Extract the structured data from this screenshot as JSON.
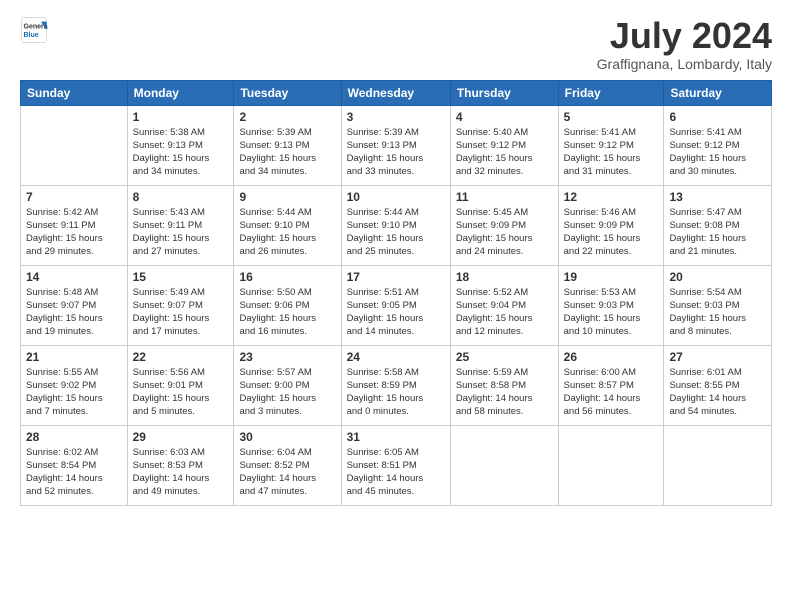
{
  "header": {
    "logo_line1": "General",
    "logo_line2": "Blue",
    "month": "July 2024",
    "location": "Graffignana, Lombardy, Italy"
  },
  "days_of_week": [
    "Sunday",
    "Monday",
    "Tuesday",
    "Wednesday",
    "Thursday",
    "Friday",
    "Saturday"
  ],
  "weeks": [
    [
      {
        "day": "",
        "info": ""
      },
      {
        "day": "1",
        "info": "Sunrise: 5:38 AM\nSunset: 9:13 PM\nDaylight: 15 hours\nand 34 minutes."
      },
      {
        "day": "2",
        "info": "Sunrise: 5:39 AM\nSunset: 9:13 PM\nDaylight: 15 hours\nand 34 minutes."
      },
      {
        "day": "3",
        "info": "Sunrise: 5:39 AM\nSunset: 9:13 PM\nDaylight: 15 hours\nand 33 minutes."
      },
      {
        "day": "4",
        "info": "Sunrise: 5:40 AM\nSunset: 9:12 PM\nDaylight: 15 hours\nand 32 minutes."
      },
      {
        "day": "5",
        "info": "Sunrise: 5:41 AM\nSunset: 9:12 PM\nDaylight: 15 hours\nand 31 minutes."
      },
      {
        "day": "6",
        "info": "Sunrise: 5:41 AM\nSunset: 9:12 PM\nDaylight: 15 hours\nand 30 minutes."
      }
    ],
    [
      {
        "day": "7",
        "info": "Sunrise: 5:42 AM\nSunset: 9:11 PM\nDaylight: 15 hours\nand 29 minutes."
      },
      {
        "day": "8",
        "info": "Sunrise: 5:43 AM\nSunset: 9:11 PM\nDaylight: 15 hours\nand 27 minutes."
      },
      {
        "day": "9",
        "info": "Sunrise: 5:44 AM\nSunset: 9:10 PM\nDaylight: 15 hours\nand 26 minutes."
      },
      {
        "day": "10",
        "info": "Sunrise: 5:44 AM\nSunset: 9:10 PM\nDaylight: 15 hours\nand 25 minutes."
      },
      {
        "day": "11",
        "info": "Sunrise: 5:45 AM\nSunset: 9:09 PM\nDaylight: 15 hours\nand 24 minutes."
      },
      {
        "day": "12",
        "info": "Sunrise: 5:46 AM\nSunset: 9:09 PM\nDaylight: 15 hours\nand 22 minutes."
      },
      {
        "day": "13",
        "info": "Sunrise: 5:47 AM\nSunset: 9:08 PM\nDaylight: 15 hours\nand 21 minutes."
      }
    ],
    [
      {
        "day": "14",
        "info": "Sunrise: 5:48 AM\nSunset: 9:07 PM\nDaylight: 15 hours\nand 19 minutes."
      },
      {
        "day": "15",
        "info": "Sunrise: 5:49 AM\nSunset: 9:07 PM\nDaylight: 15 hours\nand 17 minutes."
      },
      {
        "day": "16",
        "info": "Sunrise: 5:50 AM\nSunset: 9:06 PM\nDaylight: 15 hours\nand 16 minutes."
      },
      {
        "day": "17",
        "info": "Sunrise: 5:51 AM\nSunset: 9:05 PM\nDaylight: 15 hours\nand 14 minutes."
      },
      {
        "day": "18",
        "info": "Sunrise: 5:52 AM\nSunset: 9:04 PM\nDaylight: 15 hours\nand 12 minutes."
      },
      {
        "day": "19",
        "info": "Sunrise: 5:53 AM\nSunset: 9:03 PM\nDaylight: 15 hours\nand 10 minutes."
      },
      {
        "day": "20",
        "info": "Sunrise: 5:54 AM\nSunset: 9:03 PM\nDaylight: 15 hours\nand 8 minutes."
      }
    ],
    [
      {
        "day": "21",
        "info": "Sunrise: 5:55 AM\nSunset: 9:02 PM\nDaylight: 15 hours\nand 7 minutes."
      },
      {
        "day": "22",
        "info": "Sunrise: 5:56 AM\nSunset: 9:01 PM\nDaylight: 15 hours\nand 5 minutes."
      },
      {
        "day": "23",
        "info": "Sunrise: 5:57 AM\nSunset: 9:00 PM\nDaylight: 15 hours\nand 3 minutes."
      },
      {
        "day": "24",
        "info": "Sunrise: 5:58 AM\nSunset: 8:59 PM\nDaylight: 15 hours\nand 0 minutes."
      },
      {
        "day": "25",
        "info": "Sunrise: 5:59 AM\nSunset: 8:58 PM\nDaylight: 14 hours\nand 58 minutes."
      },
      {
        "day": "26",
        "info": "Sunrise: 6:00 AM\nSunset: 8:57 PM\nDaylight: 14 hours\nand 56 minutes."
      },
      {
        "day": "27",
        "info": "Sunrise: 6:01 AM\nSunset: 8:55 PM\nDaylight: 14 hours\nand 54 minutes."
      }
    ],
    [
      {
        "day": "28",
        "info": "Sunrise: 6:02 AM\nSunset: 8:54 PM\nDaylight: 14 hours\nand 52 minutes."
      },
      {
        "day": "29",
        "info": "Sunrise: 6:03 AM\nSunset: 8:53 PM\nDaylight: 14 hours\nand 49 minutes."
      },
      {
        "day": "30",
        "info": "Sunrise: 6:04 AM\nSunset: 8:52 PM\nDaylight: 14 hours\nand 47 minutes."
      },
      {
        "day": "31",
        "info": "Sunrise: 6:05 AM\nSunset: 8:51 PM\nDaylight: 14 hours\nand 45 minutes."
      },
      {
        "day": "",
        "info": ""
      },
      {
        "day": "",
        "info": ""
      },
      {
        "day": "",
        "info": ""
      }
    ]
  ]
}
